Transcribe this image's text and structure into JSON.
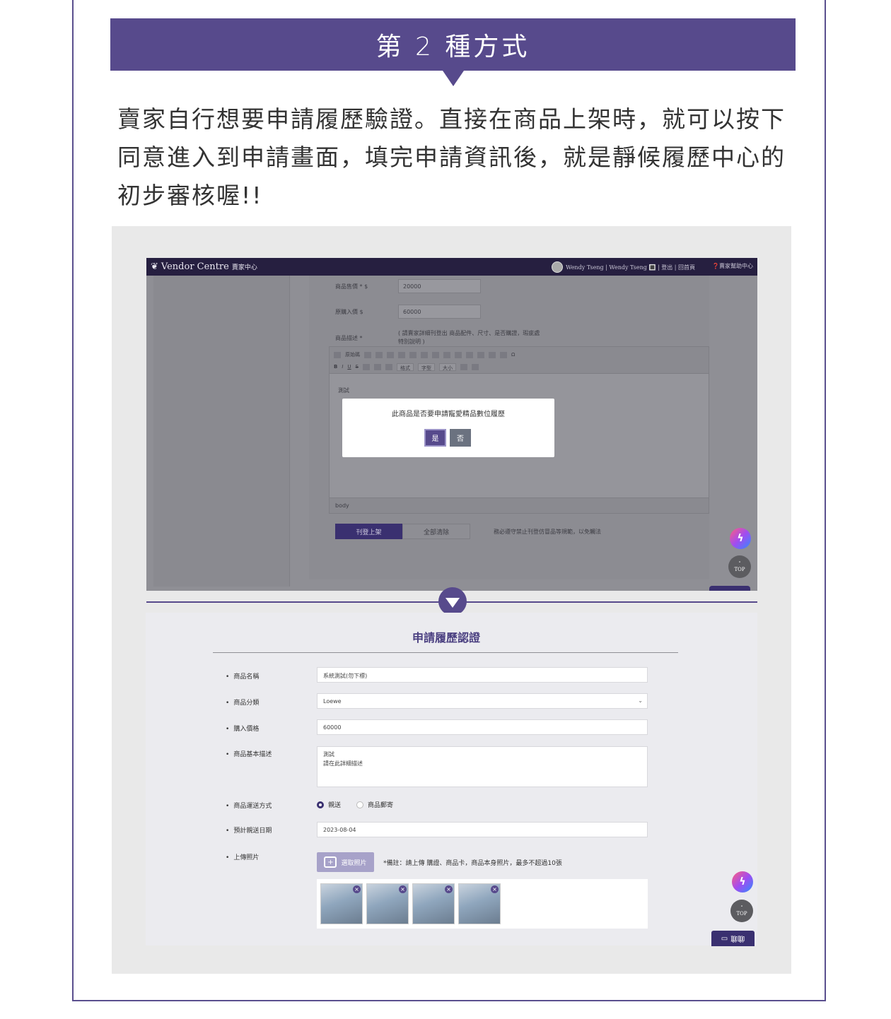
{
  "banner": {
    "title": "第 2 種方式"
  },
  "intro": {
    "text": "賣家自行想要申請履歷驗證。直接在商品上架時，就可以按下同意進入到申請畫面，填完申請資訊後，就是靜候履歷中心的初步審核喔!!"
  },
  "top_screen": {
    "brand": "Vendor Centre",
    "brand_sub": "賣家中心",
    "user_links": "Wendy Tseng | Wendy Tseng 🔳 | 登出 | 回首頁",
    "help": "❓賣家幫助中心",
    "fields": {
      "price_label": "商品售價 * $",
      "price_value": "20000",
      "cost_label": "原購入價 $",
      "cost_value": "60000",
      "desc_label": "商品描述 *",
      "desc_note": "( 請賣家詳細刊登出 商品配件、尺寸、是否購證，瑕疵處\n特別說明 )"
    },
    "editor": {
      "source_btn": "原始碼",
      "format_dd": "格式",
      "font_dd": "字型",
      "size_dd": "大小",
      "body_text": "測試",
      "footer": "body"
    },
    "modal": {
      "message": "此商品是否要申請寵愛精品數位履歷",
      "yes": "是",
      "no": "否"
    },
    "publish_btn": "刊登上架",
    "clear_btn": "全部清除",
    "warning": "務必遵守禁止刊登仿冒品等規範，以免觸法",
    "top_label": "TOP"
  },
  "bottom_screen": {
    "title": "申請履歷認證",
    "fields": [
      {
        "label": "商品名稱",
        "value": "系統測試(勿下標)"
      },
      {
        "label": "商品分類",
        "value": "Loewe"
      },
      {
        "label": "購入價格",
        "value": "60000"
      },
      {
        "label": "商品基本描述",
        "value": "測試\n請在此詳細描述"
      },
      {
        "label": "商品運送方式",
        "value": ""
      },
      {
        "label": "預計親送日期",
        "value": "2023-08-04"
      },
      {
        "label": "上傳照片",
        "value": ""
      }
    ],
    "shipping_options": [
      "親送",
      "商品郵寄"
    ],
    "shipping_selected": "親送",
    "upload_btn": "選取照片",
    "upload_note": "*備註：請上傳 購證、商品卡，商品本身照片，最多不超過10張",
    "photo_count": 4,
    "top_label": "TOP",
    "chat_btn": "聊聊"
  },
  "colors": {
    "brand": "#574a8c",
    "nav": "#261f40"
  }
}
